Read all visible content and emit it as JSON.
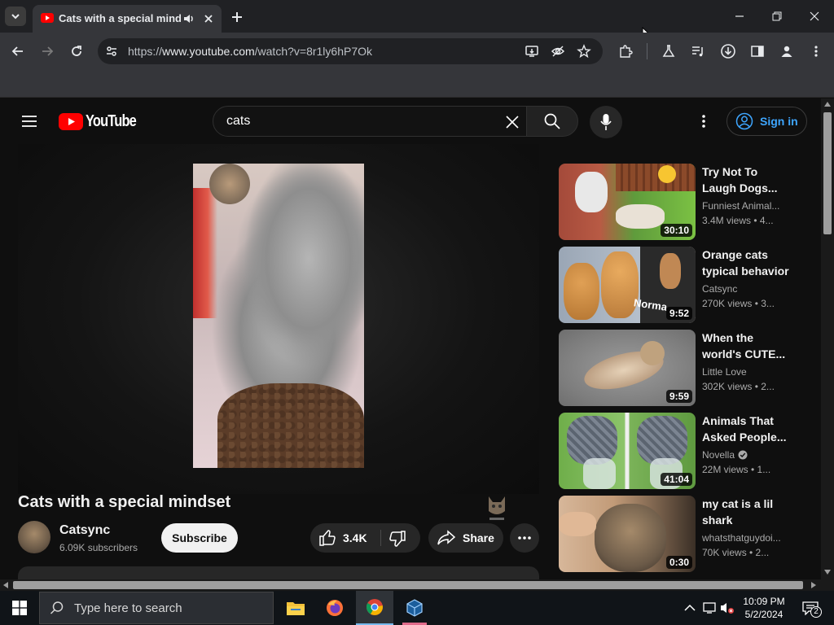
{
  "browser": {
    "tab_title": "Cats with a special mindset",
    "url_prefix": "https://",
    "url_host": "www.youtube.com",
    "url_path": "/watch?v=8r1ly6hP7Ok"
  },
  "youtube": {
    "logo_text": "YouTube",
    "search_value": "cats",
    "sign_in_label": "Sign in"
  },
  "video": {
    "title": "Cats with a special mindset",
    "channel": "Catsync",
    "subscribers": "6.09K subscribers",
    "subscribe_label": "Subscribe",
    "likes": "3.4K",
    "share_label": "Share"
  },
  "recommendations": [
    {
      "title": "Try Not To Laugh Dogs...",
      "channel": "Funniest Animal...",
      "meta": "3.4M views • 4...",
      "duration": "30:10",
      "verified": false
    },
    {
      "title": "Orange cats typical behavior",
      "channel": "Catsync",
      "meta": "270K views • 3...",
      "duration": "9:52",
      "verified": false
    },
    {
      "title": "When the world's CUTE...",
      "channel": "Little Love",
      "meta": "302K views • 2...",
      "duration": "9:59",
      "verified": false
    },
    {
      "title": "Animals That Asked People...",
      "channel": "Novella",
      "meta": "22M views • 1...",
      "duration": "41:04",
      "verified": true
    },
    {
      "title": "my cat is a lil shark",
      "channel": "whatsthatguydoi...",
      "meta": "70K views • 2...",
      "duration": "0:30",
      "verified": false
    }
  ],
  "taskbar": {
    "search_placeholder": "Type here to search",
    "time": "10:09 PM",
    "date": "5/2/2024",
    "notification_count": "2"
  }
}
